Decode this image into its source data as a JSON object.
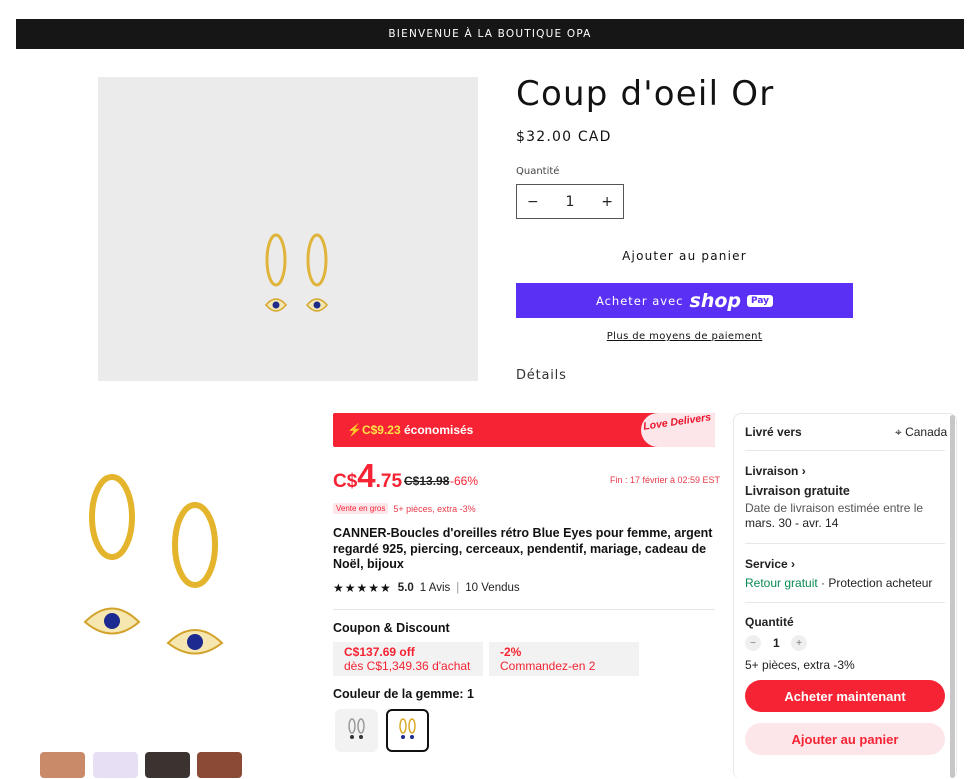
{
  "announcement": "BIENVENUE À LA BOUTIQUE OPA",
  "product": {
    "title": "Coup d'oeil Or",
    "price": "$32.00 CAD",
    "quantity_label": "Quantité",
    "quantity_value": "1",
    "minus": "−",
    "plus": "+",
    "add_to_cart": "Ajouter au panier",
    "shop_pay_prefix": "Acheter avec",
    "shop_pay_mark": "shop",
    "shop_pay_badge": "Pay",
    "more_payment": "Plus de moyens de paiement",
    "details": "Détails"
  },
  "listing": {
    "banner_amount": "C$9.23",
    "banner_text": " économisés",
    "banner_love": "Love Delivers",
    "price_currency": "C$",
    "price_int": "4",
    "price_dec": ".75",
    "old_price": "C$13.98",
    "discount": "-66%",
    "ends": "Fin : 17 février à 02:59 EST",
    "wholesale_tag": "Vente en gros",
    "wholesale_text": "5+ pièces, extra -3%",
    "title": "CANNER-Boucles d'oreilles rétro Blue Eyes pour femme, argent regardé 925, piercing, cerceaux, pendentif, mariage, cadeau de Noël, bijoux",
    "stars": "★★★★★",
    "rating": "5.0",
    "reviews": "1 Avis",
    "sold": "10 Vendus",
    "coupon_heading": "Coupon & Discount",
    "coupon1_line1": "C$137.69 off",
    "coupon1_line2": "dès C$1,349.36 d'achat",
    "coupon2_line1": "-2%",
    "coupon2_line2": "Commandez-en 2",
    "gem_heading": "Couleur de la gemme: 1"
  },
  "panel": {
    "ship_to": "Livré vers",
    "country": "Canada",
    "shipping": "Livraison",
    "free_shipping": "Livraison gratuite",
    "delivery_prefix": "Date de livraison estimée entre le ",
    "delivery_dates": "mars. 30 - avr. 14",
    "service": "Service",
    "free_return": "Retour gratuit",
    "protection": " · Protection acheteur",
    "quantity": "Quantité",
    "qty_value": "1",
    "minus": "−",
    "plus": "+",
    "wholesale_note": "5+ pièces, extra -3%",
    "buy_now": "Acheter maintenant",
    "add_to_cart": "Ajouter au panier"
  },
  "colors": {
    "accent_red": "#f52333",
    "shop_pay": "#5a31f4",
    "announcement_bg": "#161616"
  }
}
